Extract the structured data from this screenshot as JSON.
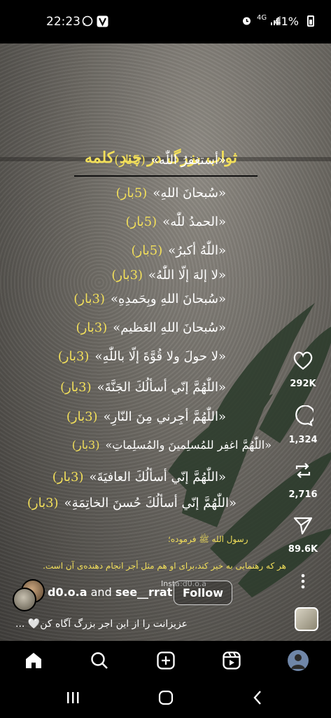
{
  "status_bar": {
    "time": "22:23",
    "network": "4G",
    "battery": "41%"
  },
  "post": {
    "title": "ثواب بزرگ در چند کلمه",
    "dhikr_items": [
      {
        "text": "«أستغفرُ اللّٰه»",
        "count": "(5بار)"
      },
      {
        "text": "«سُبحانَ اللهِ»",
        "count": "(5بار)"
      },
      {
        "text": "«الحمدُ للّٰه»",
        "count": "(5بار)"
      },
      {
        "text": "«اللّٰهُ أكبرُ»",
        "count": "(5بار)"
      },
      {
        "text": "«لا إلهَ إلّا اللّٰهُ»",
        "count": "(3بار)"
      },
      {
        "text": "«سُبحانَ اللهِ وبِحَمدِهِ»",
        "count": "(3بار)"
      },
      {
        "text": "«سُبحانَ اللهِ العَظيم»",
        "count": "(3بار)"
      },
      {
        "text": "«لا حولَ ولا قُوَّةَ إلّا باللّٰهِ»",
        "count": "(3بار)"
      },
      {
        "text": "«اللّٰهُمَّ إنّي أسألُكَ الجَنَّةَ»",
        "count": "(3بار)"
      },
      {
        "text": "«اللّٰهُمَّ أجِرني مِنَ النّارِ»",
        "count": "(3بار)"
      },
      {
        "text": "«اللّٰهُمَّ اغفِر للمُسلِمينَ والمُسلِماتِ»",
        "count": "(3بار)"
      },
      {
        "text": "«اللّٰهُمَّ إنّي أسألُكَ العافيَةَ»",
        "count": "(3بار)"
      },
      {
        "text": "«اللّٰهُمَّ إنّي أسألُكَ حُسنَ الخاتِمَةِ»",
        "count": "(3بار)"
      }
    ],
    "footer_source": "رسول الله ﷺ فرموده؛",
    "footer_text": "هر که رهنمایی به خیر کند،برای او هم مثل أجر انجام دهنده‌ی آن است.",
    "watermark": "Insta:d0.o.a"
  },
  "actions": {
    "likes": "292K",
    "comments": "1,324",
    "reposts": "2,716",
    "shares": "89.6K"
  },
  "author": {
    "name1": "d0.o.a",
    "joiner": "and",
    "name2": "see__rrat",
    "follow_label": "Follow"
  },
  "caption": "عزیزانت را از این اجر بزرگ آگاه کن🤍 ...",
  "colors": {
    "accent_yellow": "#f2df5a",
    "background": "#000000"
  },
  "icons": [
    "home-icon",
    "search-icon",
    "create-icon",
    "reels-icon",
    "profile-avatar"
  ]
}
